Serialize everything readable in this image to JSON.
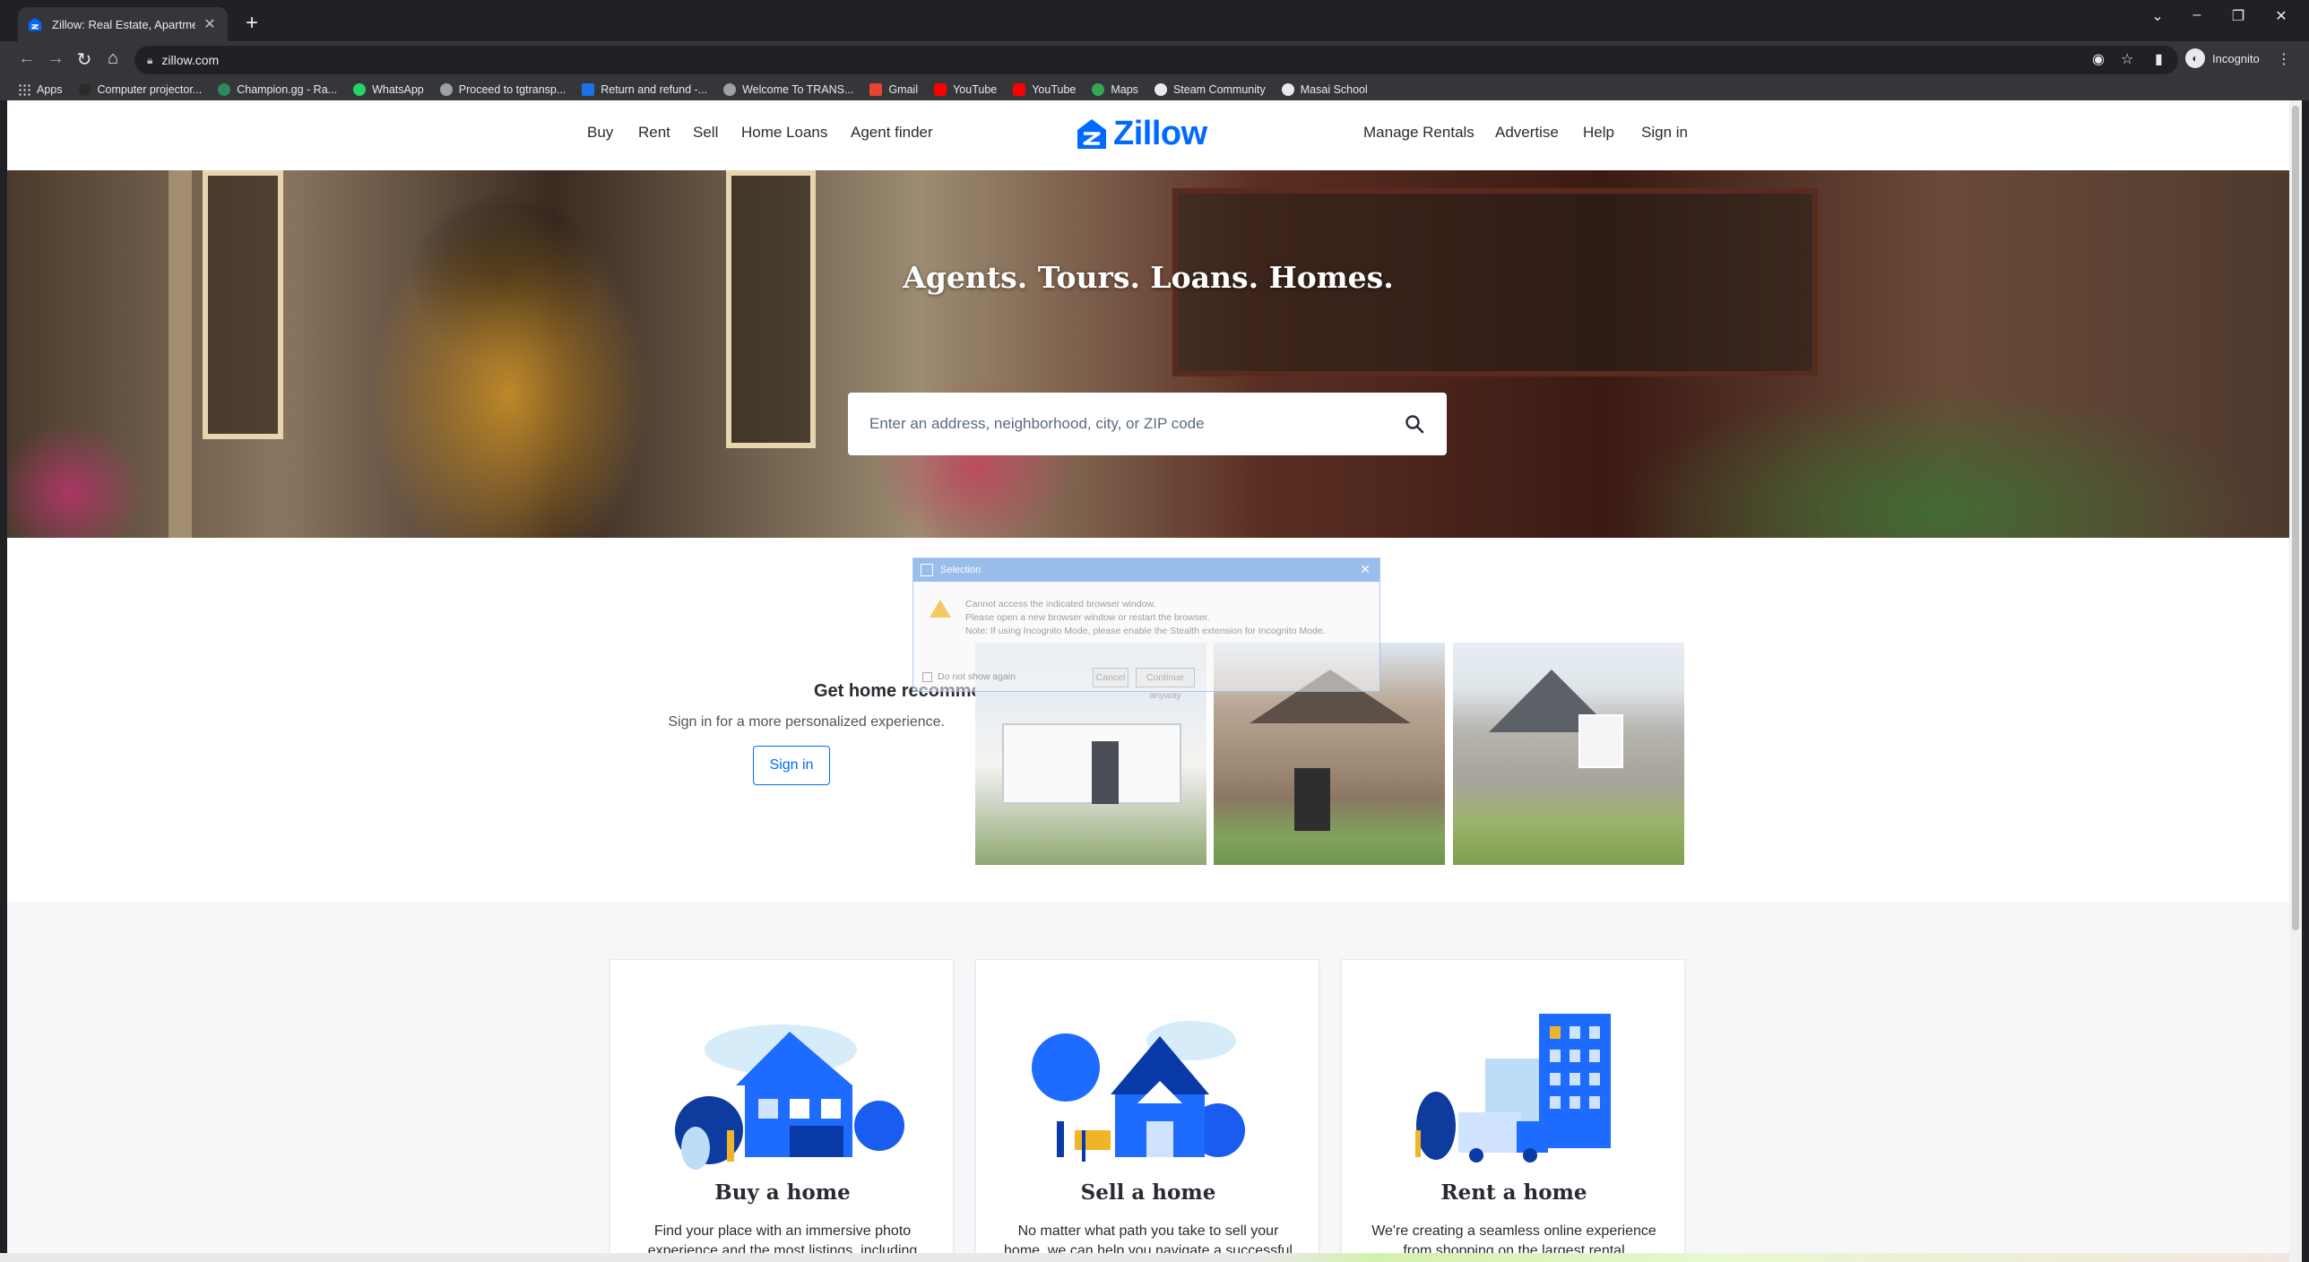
{
  "browser": {
    "tab_title": "Zillow: Real Estate, Apartments, M",
    "url": "zillow.com",
    "incognito_label": "Incognito",
    "bookmarks": [
      {
        "label": "Apps",
        "color": "#9aa0a6"
      },
      {
        "label": "Computer projector...",
        "color": "#2b2b2b"
      },
      {
        "label": "Champion.gg - Ra...",
        "color": "#2e8b57"
      },
      {
        "label": "WhatsApp",
        "color": "#25d366"
      },
      {
        "label": "Proceed to tgtransp...",
        "color": "#9aa0a6"
      },
      {
        "label": "Return and refund -...",
        "color": "#1a73e8"
      },
      {
        "label": "Welcome To TRANS...",
        "color": "#9aa0a6"
      },
      {
        "label": "Gmail",
        "color": "#ea4335"
      },
      {
        "label": "YouTube",
        "color": "#ff0000"
      },
      {
        "label": "YouTube",
        "color": "#ff0000"
      },
      {
        "label": "Maps",
        "color": "#34a853"
      },
      {
        "label": "Steam Community",
        "color": "#e8eaed"
      },
      {
        "label": "Masai School",
        "color": "#e8eaed"
      }
    ]
  },
  "nav": {
    "left": [
      "Buy",
      "Rent",
      "Sell",
      "Home Loans",
      "Agent finder"
    ],
    "right": [
      "Manage Rentals",
      "Advertise",
      "Help",
      "Sign in"
    ],
    "logo_text": "Zillow",
    "brand_color": "#006aff"
  },
  "hero": {
    "title": "Agents. Tours. Loans. Homes.",
    "search_placeholder": "Enter an address, neighborhood, city, or ZIP code"
  },
  "recommendations": {
    "title": "Get home recommendations",
    "subtitle": "Sign in for a more personalized experience.",
    "button": "Sign in"
  },
  "dialog": {
    "title": "Selection",
    "line1": "Cannot access the indicated browser window.",
    "line2": "Please open a new browser window or restart the browser.",
    "line3": "Note: If using Incognito Mode, please enable the Stealth extension for Incognito Mode.",
    "checkbox": "Do not show again",
    "cancel": "Cancel",
    "continue": "Continue anyway"
  },
  "cards": [
    {
      "title": "Buy a home",
      "desc": "Find your place with an immersive photo experience and the most listings, including"
    },
    {
      "title": "Sell a home",
      "desc": "No matter what path you take to sell your home, we can help you navigate a successful"
    },
    {
      "title": "Rent a home",
      "desc": "We're creating a seamless online experience from shopping on the largest rental"
    }
  ]
}
